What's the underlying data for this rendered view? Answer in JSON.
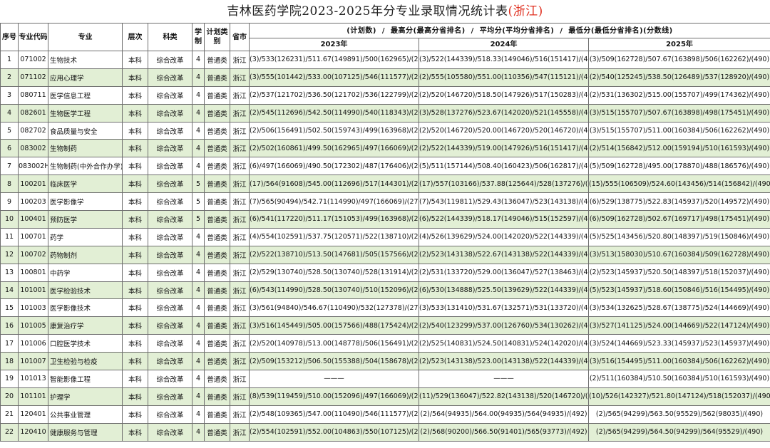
{
  "page": {
    "title_main": "吉林医药学院2023-2025年分专业录取情况统计表",
    "title_region_prefix": "(",
    "title_region": "浙江",
    "title_region_suffix": ")"
  },
  "header": {
    "seq": "序号",
    "code": "专业代码",
    "major": "专业",
    "level": "层次",
    "subject": "科类",
    "years": "学制",
    "plan_type": "计划类别",
    "province": "省市",
    "description": "(计划数)  /  最高分(最高分省排名)  /  平均分(平均分省排名)  /  最低分(最低分省排名)(分数线)",
    "year_labels": [
      "2023年",
      "2024年",
      "2025年"
    ]
  },
  "colors": {
    "alt_row": "#e2efd5",
    "border": "#6f6f6f",
    "region_text": "#e03020"
  },
  "rows": [
    {
      "seq": "1",
      "code": "071002",
      "major": "生物技术",
      "level": "本科",
      "subject": "综合改革",
      "years": "4",
      "plan_type": "普通类",
      "province": "浙江",
      "y2023": "(3)/533(126231)/511.67(149891)/500(162965)/(274)",
      "y2024": "(3)/522(144339)/518.33(149046)/516(151417)/(492)",
      "y2025": "(3)/509(162728)/507.67(163898)/506(162262)/(490)"
    },
    {
      "seq": "2",
      "code": "071102",
      "major": "应用心理学",
      "level": "本科",
      "subject": "综合改革",
      "years": "4",
      "plan_type": "普通类",
      "province": "浙江",
      "y2023": "(3)/555(101442)/533.00(107125)/546(111577)/(274)",
      "y2024": "(2)/555(105580)/551.00(110356)/547(115121)/(492)",
      "y2025": "(2)/540(125245)/538.50(126489)/537(128920)/(490)"
    },
    {
      "seq": "3",
      "code": "080711",
      "major": "医学信息工程",
      "level": "本科",
      "subject": "综合改革",
      "years": "4",
      "plan_type": "普通类",
      "province": "浙江",
      "y2023": "(2)/537(121702)/536.50(121702)/536(122799)/(274)",
      "y2024": "(2)/520(146720)/518.50(147926)/517(150283)/(492)",
      "y2025": "(2)/531(136302)/515.00(155707)/499(174362)/(490)"
    },
    {
      "seq": "4",
      "code": "082601",
      "major": "生物医学工程",
      "level": "本科",
      "subject": "综合改革",
      "years": "4",
      "plan_type": "普通类",
      "province": "浙江",
      "y2023": "(2)/545(112696)/542.50(114990)/540(118343)/(274)",
      "y2024": "(3)/528(137276)/523.67(142020)/521(145558)/(492)",
      "y2025": "(3)/515(155707)/507.67(163898)/498(175451)/(490)"
    },
    {
      "seq": "5",
      "code": "082702",
      "major": "食品质量与安全",
      "level": "本科",
      "subject": "综合改革",
      "years": "4",
      "plan_type": "普通类",
      "province": "浙江",
      "y2023": "(2)/506(156491)/502.50(159743)/499(163968)/(274)",
      "y2024": "(2)/520(146720)/520.00(146720)/520(146720)/(492)",
      "y2025": "(3)/515(155707)/511.00(160384)/506(162262)/(490)"
    },
    {
      "seq": "6",
      "code": "083002",
      "major": "生物制药",
      "level": "本科",
      "subject": "综合改革",
      "years": "4",
      "plan_type": "普通类",
      "province": "浙江",
      "y2023": "(2)/502(160861)/499.50(162965)/497(166069)/(274)",
      "y2024": "(2)/522(144339)/519.00(147926)/516(151417)/(492)",
      "y2025": "(2)/514(156842)/512.00(159194)/510(161593)/(490)"
    },
    {
      "seq": "7",
      "code": "083002H",
      "major": "生物制药(中外合作办学)",
      "level": "本科",
      "subject": "综合改革",
      "years": "4",
      "plan_type": "普通类",
      "province": "浙江",
      "y2023": "(6)/497(166069)/490.50(172302)/487(176406)/(274)",
      "y2024": "(5)/511(157144)/508.40(160423)/506(162817)/(492)",
      "y2025": "(5)/509(162728)/495.00(178870)/488(186576)/(490)"
    },
    {
      "seq": "8",
      "code": "100201",
      "major": "临床医学",
      "level": "本科",
      "subject": "综合改革",
      "years": "5",
      "plan_type": "普通类",
      "province": "浙江",
      "y2023": "(17)/564(91608)/545.00(112696)/517(144301)/(274)",
      "y2024": "(17)/557(103166)/537.88(125644)/528(137276)/(492)",
      "y2025": "(15)/555(106509)/524.60(143456)/514(156842)/(490)"
    },
    {
      "seq": "9",
      "code": "100203",
      "major": "医学影像学",
      "level": "本科",
      "subject": "综合改革",
      "years": "5",
      "plan_type": "普通类",
      "province": "浙江",
      "y2023": "(7)/565(90494)/542.71(114990)/497(166069)/(274)",
      "y2024": "(7)/543(119811)/529.43(136047)/523(143138)/(492)",
      "y2025": "(6)/529(138775)/522.83(145937)/520(149572)/(490)"
    },
    {
      "seq": "10",
      "code": "100401",
      "major": "预防医学",
      "level": "本科",
      "subject": "综合改革",
      "years": "5",
      "plan_type": "普通类",
      "province": "浙江",
      "y2023": "(6)/541(117220)/511.17(151053)/499(163968)/(274)",
      "y2024": "(6)/522(144339)/518.17(149046)/515(152597)/(492)",
      "y2025": "(6)/509(162728)/502.67(169717)/498(175451)/(490)"
    },
    {
      "seq": "11",
      "code": "100701",
      "major": "药学",
      "level": "本科",
      "subject": "综合改革",
      "years": "4",
      "plan_type": "普通类",
      "province": "浙江",
      "y2023": "(4)/554(102591)/537.75(120571)/522(138710)/(274)",
      "y2024": "(4)/526(139629)/524.00(142020)/522(144339)/(492)",
      "y2025": "(5)/525(143456)/520.80(148397)/519(150846)/(490)"
    },
    {
      "seq": "12",
      "code": "100702",
      "major": "药物制剂",
      "level": "本科",
      "subject": "综合改革",
      "years": "4",
      "plan_type": "普通类",
      "province": "浙江",
      "y2023": "(2)/522(138710)/513.50(147681)/505(157566)/(274)",
      "y2024": "(2)/523(143138)/522.67(143138)/522(144339)/(492)",
      "y2025": "(3)/513(158030)/510.67(160384)/509(162728)/(490)"
    },
    {
      "seq": "13",
      "code": "100801",
      "major": "中药学",
      "level": "本科",
      "subject": "综合改革",
      "years": "4",
      "plan_type": "普通类",
      "province": "浙江",
      "y2023": "(2)/529(130740)/528.50(130740)/528(131914)/(274)",
      "y2024": "(2)/531(133720)/529.00(136047)/527(138463)/(492)",
      "y2025": "(2)/523(145937)/520.50(148397)/518(152037)/(490)"
    },
    {
      "seq": "14",
      "code": "101001",
      "major": "医学检验技术",
      "level": "本科",
      "subject": "综合改革",
      "years": "4",
      "plan_type": "普通类",
      "province": "浙江",
      "y2023": "(6)/543(114990)/528.50(130740)/510(152096)/(274)",
      "y2024": "(6)/530(134888)/525.50(139629)/522(144339)/(492)",
      "y2025": "(5)/523(145937)/518.60(150846)/516(154495)/(490)"
    },
    {
      "seq": "15",
      "code": "101003",
      "major": "医学影像技术",
      "level": "本科",
      "subject": "综合改革",
      "years": "4",
      "plan_type": "普通类",
      "province": "浙江",
      "y2023": "(3)/561(94840)/546.67(110490)/532(127378)/(274)",
      "y2024": "(3)/533(131410)/531.67(132571)/531(133720)/(492)",
      "y2025": "(3)/534(132625)/528.67(138775)/524(144669)/(490)"
    },
    {
      "seq": "16",
      "code": "101005",
      "major": "康复治疗学",
      "level": "本科",
      "subject": "综合改革",
      "years": "4",
      "plan_type": "普通类",
      "province": "浙江",
      "y2023": "(3)/516(145449)/505.00(157566)/488(175424)/(274)",
      "y2024": "(2)/540(123299)/537.00(126760)/534(130262)/(492)",
      "y2025": "(3)/527(141125)/524.00(144669)/522(147124)/(490)"
    },
    {
      "seq": "17",
      "code": "101006",
      "major": "口腔医学技术",
      "level": "本科",
      "subject": "综合改革",
      "years": "4",
      "plan_type": "普通类",
      "province": "浙江",
      "y2023": "(2)/520(140978)/513.00(148778)/506(156491)/(274)",
      "y2024": "(2)/525(140831)/524.50(140831)/524(142020)/(492)",
      "y2025": "(3)/524(144669)/523.33(145937)/523(145937)/(490)"
    },
    {
      "seq": "18",
      "code": "101007",
      "major": "卫生检验与检疫",
      "level": "本科",
      "subject": "综合改革",
      "years": "4",
      "plan_type": "普通类",
      "province": "浙江",
      "y2023": "(2)/509(153212)/506.50(155388)/504(158678)/(274)",
      "y2024": "(2)/523(143138)/523.00(143138)/522(144339)/(492)",
      "y2025": "(3)/516(154495)/511.00(160384)/506(162262)/(490)"
    },
    {
      "seq": "19",
      "code": "101013",
      "major": "智能影像工程",
      "level": "本科",
      "subject": "综合改革",
      "years": "4",
      "plan_type": "普通类",
      "province": "浙江",
      "y2023": "———",
      "y2024": "———",
      "y2025": "(2)/511(160384)/510.50(160384)/510(161593)/(490)"
    },
    {
      "seq": "20",
      "code": "101101",
      "major": "护理学",
      "level": "本科",
      "subject": "综合改革",
      "years": "4",
      "plan_type": "普通类",
      "province": "浙江",
      "y2023": "(8)/539(119459)/510.00(152096)/497(166069)/(274)",
      "y2024": "(11)/529(136047)/522.82(143138)/520(146720)/(492)",
      "y2025": "(10)/526(142327)/521.80(147124)/518(152037)/(490)"
    },
    {
      "seq": "21",
      "code": "120401",
      "major": "公共事业管理",
      "level": "本科",
      "subject": "综合改革",
      "years": "4",
      "plan_type": "普通类",
      "province": "浙江",
      "y2023": "(2)/548(109365)/547.00(110490)/546(111577)/(274)",
      "y2024": "(2)/564(94935)/564.00(94935)/564(94935)/(492)",
      "y2025": "(2)/565(94299)/563.50(95529)/562(98035)/(490)"
    },
    {
      "seq": "22",
      "code": "120410",
      "major": "健康服务与管理",
      "level": "本科",
      "subject": "综合改革",
      "years": "4",
      "plan_type": "普通类",
      "province": "浙江",
      "y2023": "(2)/554(102591)/552.00(104863)/550(107125)/(274)",
      "y2024": "(2)/568(90200)/566.50(91401)/565(93773)/(492)",
      "y2025": "(2)/565(94299)/564.50(94299)/564(95529)/(490)"
    }
  ]
}
